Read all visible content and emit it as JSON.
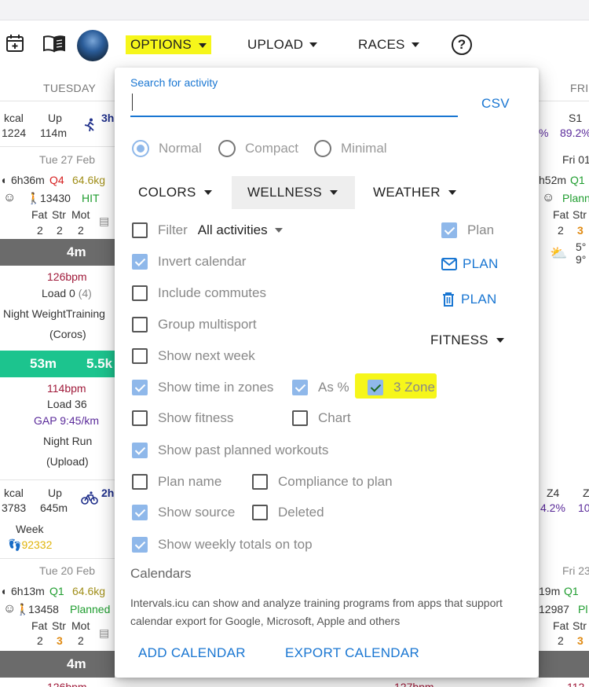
{
  "toolbar": {
    "options_label": "OPTIONS",
    "upload_label": "UPLOAD",
    "races_label": "RACES",
    "help_label": "?"
  },
  "calendar": {
    "col_tuesday": "TUESDAY",
    "col_friday": "FRI",
    "week1": {
      "kcal_label": "kcal",
      "up_label": "Up",
      "kcal": "1224",
      "up": "114m",
      "time_prefix": "3h",
      "s1_label": "S1",
      "s1_value": "89.2%",
      "pct_frag": "%"
    },
    "tue27": {
      "date": "Tue 27 Feb",
      "duration": "6h36m",
      "q": "Q4",
      "weight": "64.6kg",
      "steps": "13430",
      "tag": "HIT",
      "fat": "Fat",
      "str": "Str",
      "mot": "Mot",
      "fat_v": "2",
      "str_v": "2",
      "mot_v": "2",
      "bar1": "4m",
      "hr1": "126bpm",
      "load1": "Load 0",
      "load1_paren": "(4)",
      "name1": "Night WeightTraining",
      "src1": "(Coros)",
      "bar2_time": "53m",
      "bar2_dist": "5.5k",
      "hr2": "114bpm",
      "load2": "Load 36",
      "gap2": "GAP 9:45/km",
      "name2": "Night Run",
      "src2": "(Upload)"
    },
    "fri01": {
      "date": "Fri 01",
      "duration": "h52m",
      "q": "Q1",
      "planned": "Plann",
      "fat": "Fat",
      "str": "Str",
      "fat_v": "2",
      "str_v": "3",
      "temp_hi": "5°",
      "temp_lo": "9°"
    },
    "week2": {
      "kcal_label": "kcal",
      "up_label": "Up",
      "kcal": "3783",
      "up": "645m",
      "time_prefix": "2h",
      "week_label": "Week",
      "steps": "92332",
      "z4_label": "Z4",
      "z4_value": "4.2%",
      "z_frag": "Z",
      "z_val_frag": "10"
    },
    "tue20": {
      "date": "Tue 20 Feb",
      "duration": "6h13m",
      "q": "Q1",
      "weight": "64.6kg",
      "steps": "13458",
      "planned": "Planned",
      "fat": "Fat",
      "str": "Str",
      "mot": "Mot",
      "fat_v": "2",
      "str_v": "3",
      "mot_v": "2",
      "bar1": "4m",
      "hr_frag": "126bpm",
      "hr_frag2": "127bpm"
    },
    "fri23": {
      "date": "Fri 23",
      "duration": "19m",
      "q": "Q1",
      "steps": "12987",
      "planned": "Pl",
      "fat": "Fat",
      "str": "Str",
      "fat_v": "2",
      "str_v": "3",
      "hr_frag": "112"
    }
  },
  "options": {
    "search_label": "Search for activity",
    "search_value": "",
    "csv_label": "CSV",
    "view_modes": [
      {
        "label": "Normal",
        "selected": true
      },
      {
        "label": "Compact",
        "selected": false
      },
      {
        "label": "Minimal",
        "selected": false
      }
    ],
    "menus": {
      "colors": "COLORS",
      "wellness": "WELLNESS",
      "weather": "WEATHER",
      "fitness": "FITNESS"
    },
    "filter_label": "Filter",
    "filter_value": "All activities",
    "plan_checkbox_label": "Plan",
    "plan_email_label": "PLAN",
    "plan_delete_label": "PLAN",
    "checkboxes": {
      "filter": false,
      "invert_calendar": {
        "label": "Invert calendar",
        "checked": true
      },
      "include_commutes": {
        "label": "Include commutes",
        "checked": false
      },
      "group_multisport": {
        "label": "Group multisport",
        "checked": false
      },
      "show_next_week": {
        "label": "Show next week",
        "checked": false
      },
      "show_time_in_zones": {
        "label": "Show time in zones",
        "checked": true
      },
      "as_percent": {
        "label": "As %",
        "checked": true
      },
      "three_zone": {
        "label": "3 Zone",
        "checked": true
      },
      "show_fitness": {
        "label": "Show fitness",
        "checked": false
      },
      "chart": {
        "label": "Chart",
        "checked": false
      },
      "show_past_planned": {
        "label": "Show past planned workouts",
        "checked": true
      },
      "plan_name": {
        "label": "Plan name",
        "checked": false
      },
      "compliance": {
        "label": "Compliance to plan",
        "checked": false
      },
      "show_source": {
        "label": "Show source",
        "checked": true
      },
      "deleted": {
        "label": "Deleted",
        "checked": false
      },
      "weekly_totals_top": {
        "label": "Show weekly totals on top",
        "checked": true
      },
      "plan": {
        "checked": true
      }
    },
    "calendars_title": "Calendars",
    "calendars_desc": "Intervals.icu can show and analyze training programs from apps that support calendar export for Google, Microsoft, Apple and others",
    "add_calendar_label": "ADD CALENDAR",
    "export_calendar_label": "EXPORT CALENDAR"
  },
  "colors": {
    "accent": "#1976d2",
    "highlight": "#f6f61a",
    "checked": "#8fb8ea",
    "green_bar": "#1cc48e"
  }
}
